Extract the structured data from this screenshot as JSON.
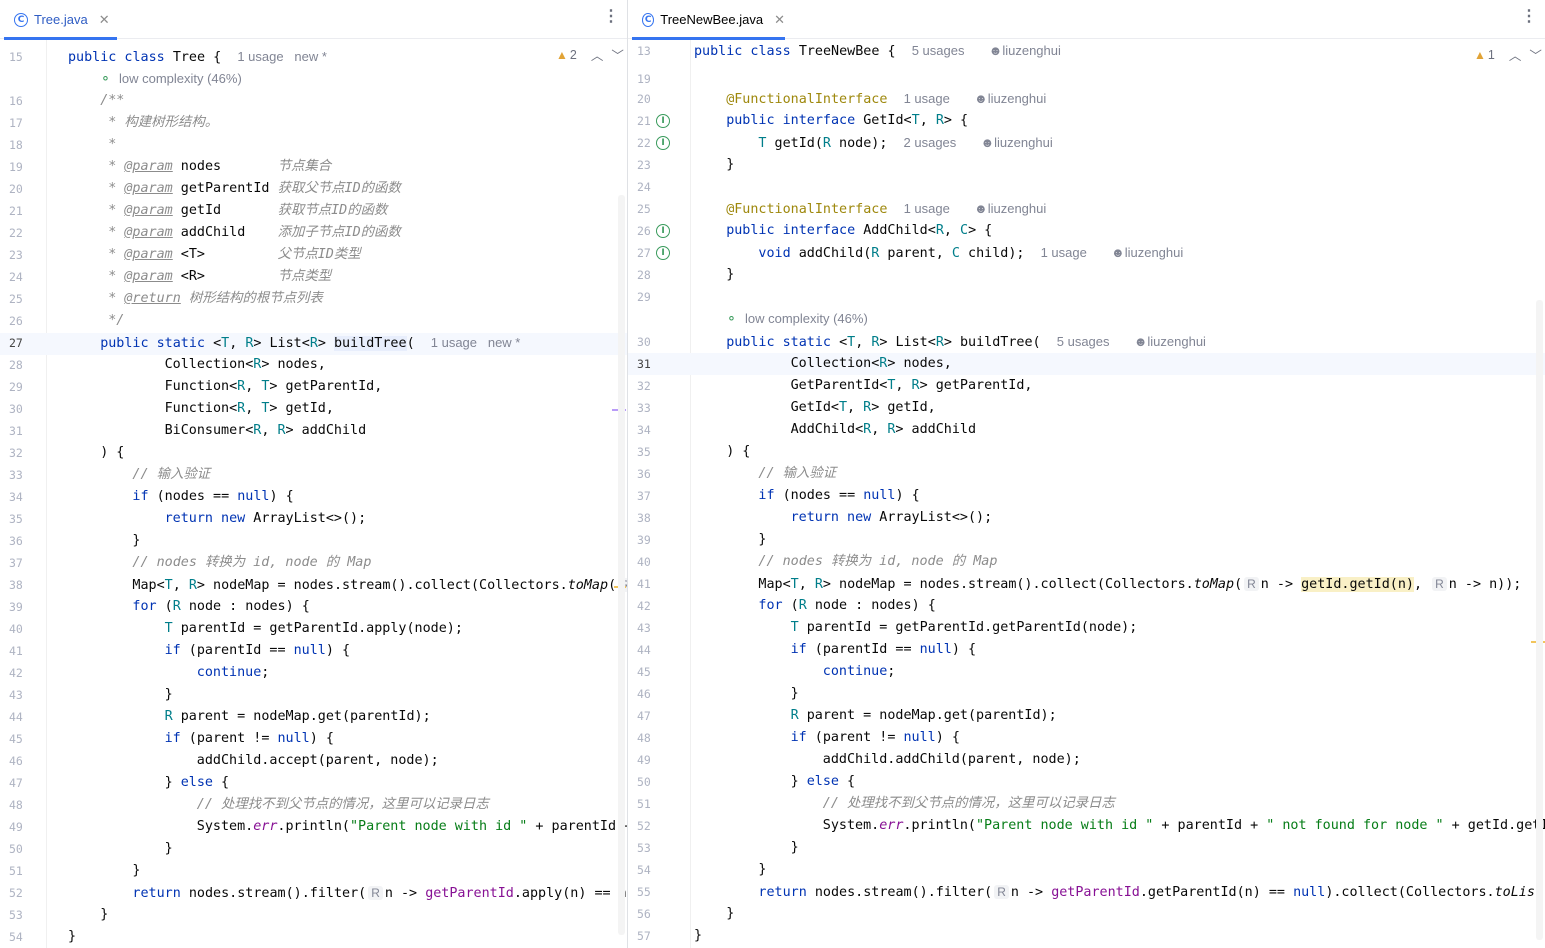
{
  "left": {
    "tab": {
      "name": "Tree.java",
      "icon": "class-icon"
    },
    "warnings": {
      "count": "2"
    },
    "class_line": {
      "line_no": "15",
      "hints": "1 usage   new *"
    },
    "complexity": "low complexity (46%)",
    "lines": [
      {
        "n": "16"
      },
      {
        "n": "17"
      },
      {
        "n": "18"
      },
      {
        "n": "19"
      },
      {
        "n": "20"
      },
      {
        "n": "21"
      },
      {
        "n": "22"
      },
      {
        "n": "23"
      },
      {
        "n": "24"
      },
      {
        "n": "25"
      },
      {
        "n": "26"
      },
      {
        "n": "27"
      },
      {
        "n": "28"
      },
      {
        "n": "29"
      },
      {
        "n": "30"
      },
      {
        "n": "31"
      },
      {
        "n": "32"
      },
      {
        "n": "33"
      },
      {
        "n": "34"
      },
      {
        "n": "35"
      },
      {
        "n": "36"
      },
      {
        "n": "37"
      },
      {
        "n": "38"
      },
      {
        "n": "39"
      },
      {
        "n": "40"
      },
      {
        "n": "41"
      },
      {
        "n": "42"
      },
      {
        "n": "43"
      },
      {
        "n": "44"
      },
      {
        "n": "45"
      },
      {
        "n": "46"
      },
      {
        "n": "47"
      },
      {
        "n": "48"
      },
      {
        "n": "49"
      },
      {
        "n": "50"
      },
      {
        "n": "51"
      },
      {
        "n": "52"
      },
      {
        "n": "53"
      },
      {
        "n": "54"
      }
    ],
    "text": {
      "javadoc_desc": "构建树形结构。",
      "p_nodes": "节点集合",
      "p_getParentId": "获取父节点ID的函数",
      "p_getId": "获取节点ID的函数",
      "p_addChild": "添加子节点ID的函数",
      "p_T": "父节点ID类型",
      "p_R": "节点类型",
      "ret": "树形结构的根节点列表",
      "c_input": "// 输入验证",
      "c_map": "// nodes 转换为 id, node 的 Map",
      "c_notfound": "// 处理找不到父节点的情况，这里可以记录日志",
      "build_hints": "1 usage   new *",
      "str_parent": "\"Parent node with id \""
    }
  },
  "right": {
    "tab": {
      "name": "TreeNewBee.java",
      "icon": "class-icon"
    },
    "warnings": {
      "count": "1"
    },
    "author": "liuzenghui",
    "class_hint": "5 usages",
    "complexity": "low complexity (46%)",
    "text": {
      "getid_usage": "1 usage",
      "getid_method_usage": "2 usages",
      "addchild_usage": "1 usage",
      "addchild_method_usage": "1 usage",
      "build_usage": "5 usages",
      "c_input": "// 输入验证",
      "c_map": "// nodes 转换为 id, node 的 Map",
      "c_notfound": "// 处理找不到父节点的情况，这里可以记录日志",
      "str_parent": "\"Parent node with id \"",
      "str_notfound": "\" not found for node \""
    },
    "lines": [
      "13",
      "19",
      "20",
      "21",
      "22",
      "23",
      "24",
      "25",
      "26",
      "27",
      "28",
      "29",
      "30",
      "31",
      "32",
      "33",
      "34",
      "35",
      "36",
      "37",
      "38",
      "39",
      "40",
      "41",
      "42",
      "43",
      "44",
      "45",
      "46",
      "47",
      "48",
      "49",
      "50",
      "51",
      "52",
      "53",
      "54",
      "55",
      "56",
      "57"
    ]
  }
}
